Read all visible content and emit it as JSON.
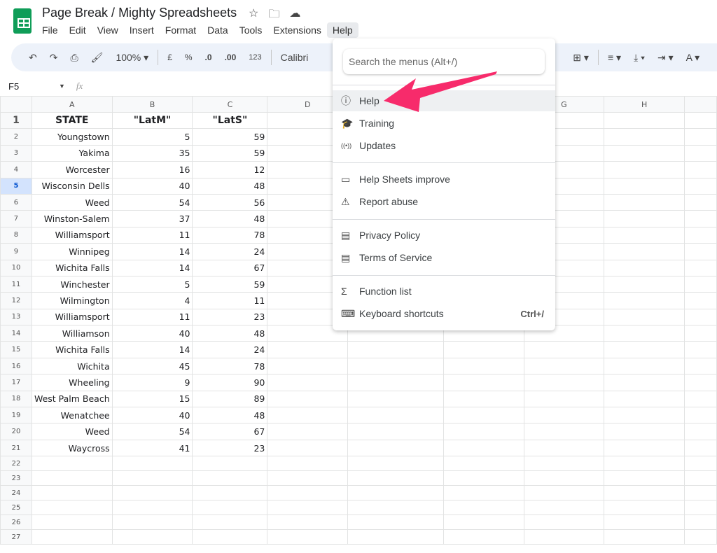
{
  "doc": {
    "title": "Page Break / Mighty Spreadsheets"
  },
  "menubar": [
    "File",
    "Edit",
    "View",
    "Insert",
    "Format",
    "Data",
    "Tools",
    "Extensions",
    "Help"
  ],
  "toolbar": {
    "zoom": "100%",
    "currency": "£",
    "percent": "%",
    "dec_dec": ".0",
    "inc_dec": ".00",
    "format": "123",
    "font": "Calibri"
  },
  "formula_bar": {
    "cell_ref": "F5",
    "fx": "fx",
    "value": ""
  },
  "columns": [
    "A",
    "B",
    "C",
    "D",
    "E",
    "F",
    "G",
    "H"
  ],
  "header_row": [
    "STATE",
    "\"LatM\"",
    "\"LatS\""
  ],
  "rows": [
    [
      "Youngstown",
      5,
      59
    ],
    [
      "Yakima",
      35,
      59
    ],
    [
      "Worcester",
      16,
      12
    ],
    [
      "Wisconsin Dells",
      40,
      48
    ],
    [
      "Weed",
      54,
      56
    ],
    [
      "Winston-Salem",
      37,
      48
    ],
    [
      "Williamsport",
      11,
      78
    ],
    [
      "Winnipeg",
      14,
      24
    ],
    [
      "Wichita Falls",
      14,
      67
    ],
    [
      "Winchester",
      5,
      59
    ],
    [
      "Wilmington",
      4,
      11
    ],
    [
      "Williamsport",
      11,
      23
    ],
    [
      "Williamson",
      40,
      48
    ],
    [
      "Wichita Falls",
      14,
      24
    ],
    [
      "Wichita",
      45,
      78
    ],
    [
      "Wheeling",
      9,
      90
    ],
    [
      "West Palm Beach",
      15,
      89
    ],
    [
      "Wenatchee",
      40,
      48
    ],
    [
      "Weed",
      54,
      67
    ],
    [
      "Waycross",
      41,
      23
    ]
  ],
  "selected_row": 5,
  "help_menu": {
    "search_placeholder": "Search the menus (Alt+/)",
    "items": [
      {
        "label": "Help",
        "icon": "help-circle-icon"
      },
      {
        "label": "Training",
        "icon": "graduation-cap-icon"
      },
      {
        "label": "Updates",
        "icon": "broadcast-icon"
      },
      {
        "label": "Help Sheets improve",
        "icon": "feedback-icon"
      },
      {
        "label": "Report abuse",
        "icon": "warning-icon"
      },
      {
        "label": "Privacy Policy",
        "icon": "document-icon"
      },
      {
        "label": "Terms of Service",
        "icon": "document-icon"
      },
      {
        "label": "Function list",
        "icon": "sigma-icon"
      },
      {
        "label": "Keyboard shortcuts",
        "icon": "keyboard-icon",
        "shortcut": "Ctrl+/"
      }
    ]
  },
  "annotation_color": "#f72b6b"
}
